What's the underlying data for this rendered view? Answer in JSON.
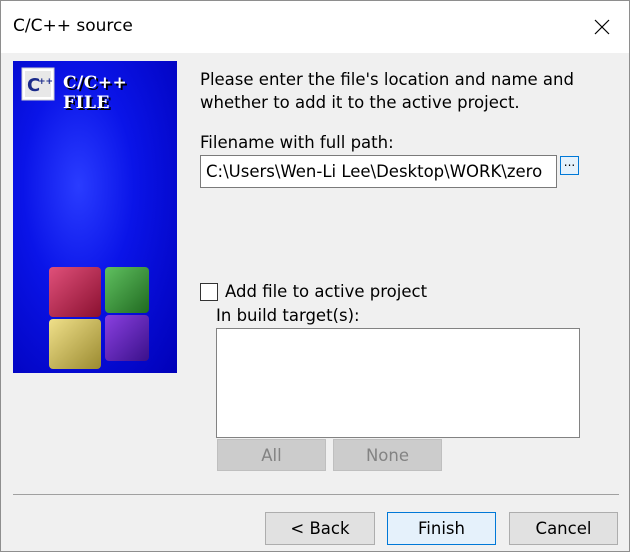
{
  "window": {
    "title": "C/C++ source"
  },
  "banner": {
    "text": "C/C++ FILE"
  },
  "intro": "Please enter the file's location and name and whether to add it to the active project.",
  "filename": {
    "label": "Filename with full path:",
    "value": "C:\\Users\\Wen-Li Lee\\Desktop\\WORK\\zero",
    "browse_label": "..."
  },
  "add_to_project": {
    "label": "Add file to active project",
    "checked": false
  },
  "build_targets": {
    "label": "In build target(s):",
    "items": [],
    "all_label": "All",
    "none_label": "None"
  },
  "footer": {
    "back_label": "< Back",
    "finish_label": "Finish",
    "cancel_label": "Cancel"
  },
  "colors": {
    "banner_blue": "#0000e0",
    "focus_border": "#0078d7"
  }
}
